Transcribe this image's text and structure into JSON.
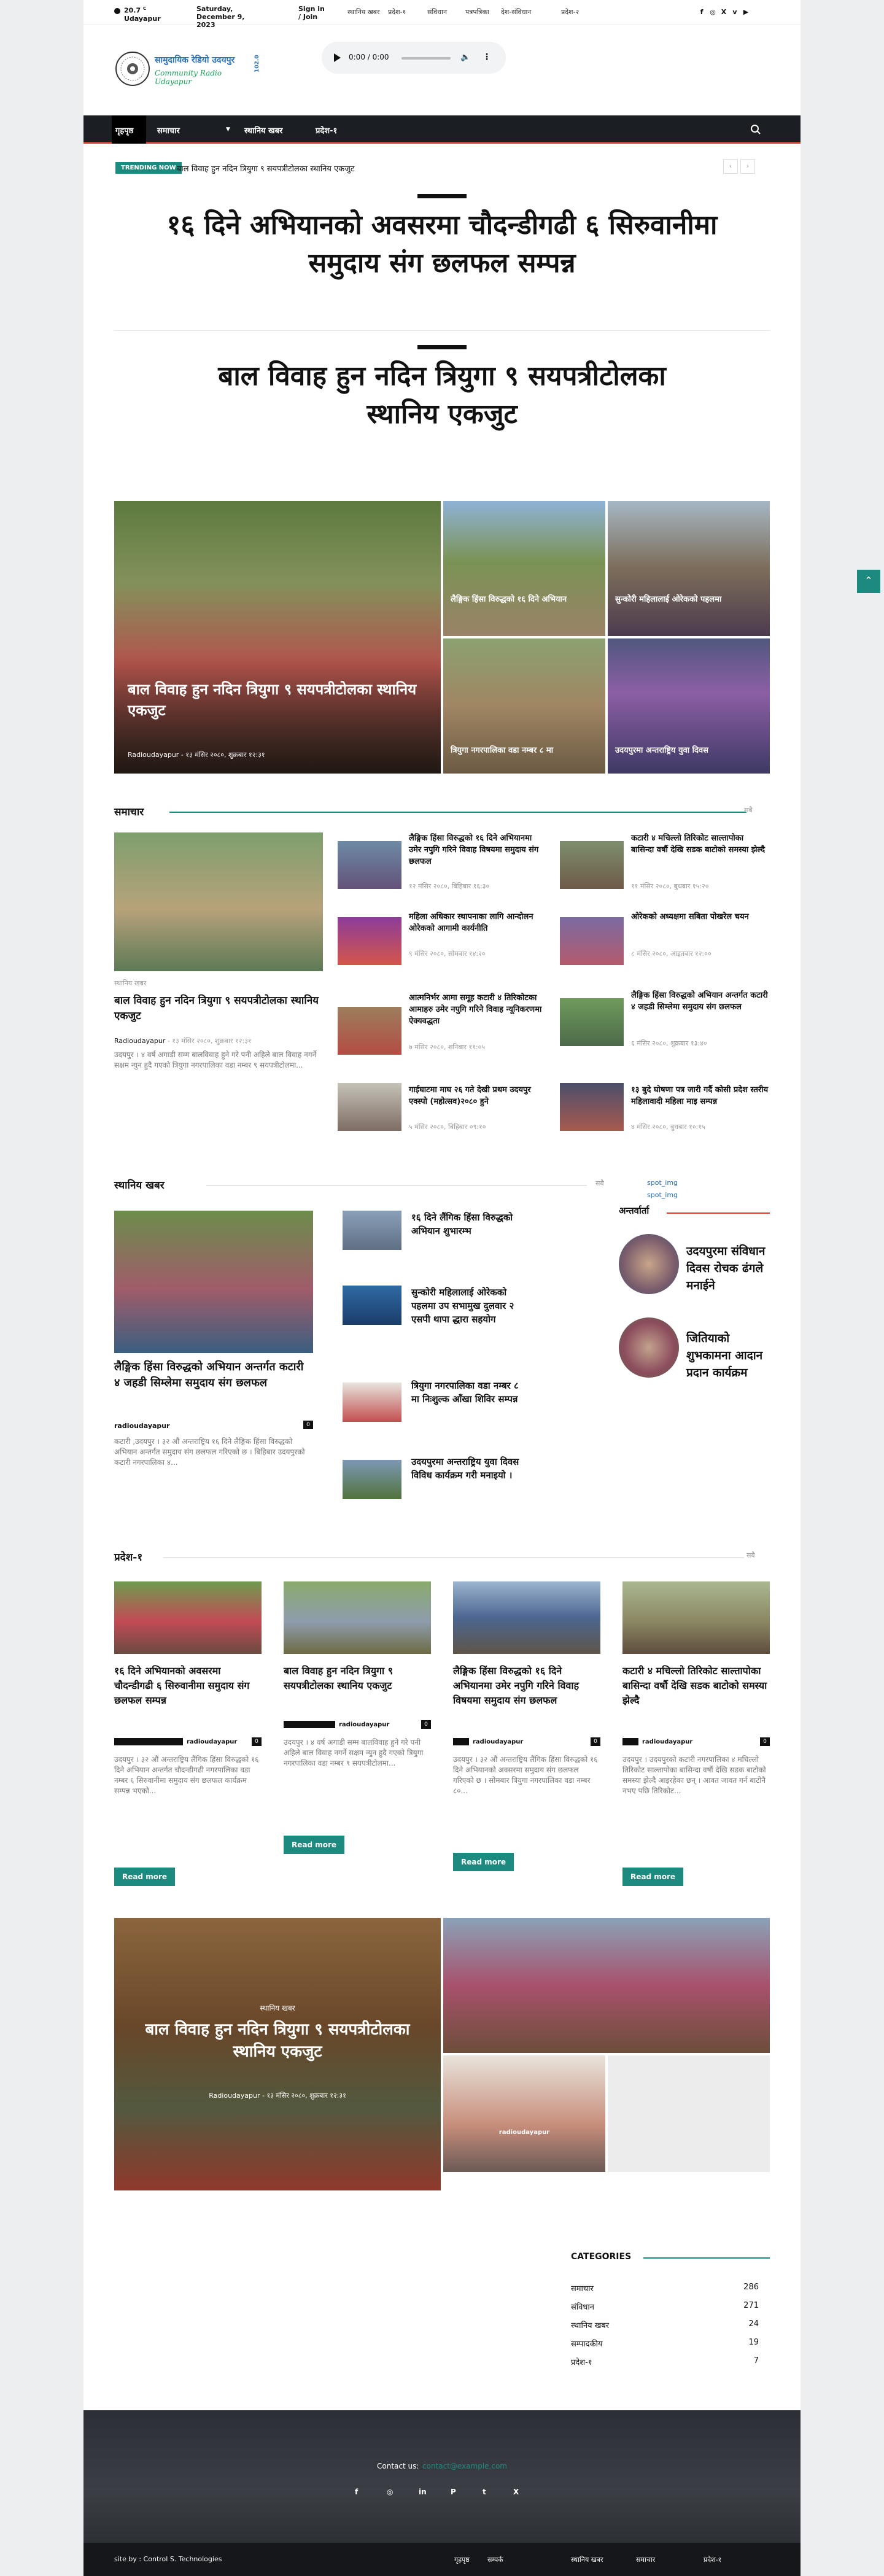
{
  "topbar": {
    "weather_temp": "20.7",
    "weather_unit": "C",
    "weather_city": "Udayapur",
    "date": "Saturday, December 9, 2023",
    "signin": "Sign in / Join",
    "links": [
      "स्थानिय खबर",
      "प्रदेश-१",
      "संविधान",
      "पत्रपत्रिका",
      "देश-संविधान",
      "प्रदेश-२"
    ]
  },
  "header": {
    "logo_title": "सामुदायिक रेडियो उदयपुर",
    "logo_sub": "Community Radio Udayapur",
    "logo_freq": "102.0",
    "player_time": "0:00 / 0:00"
  },
  "nav": {
    "items": [
      "गृहपृष्ठ",
      "समाचार",
      "स्थानिय खबर",
      "प्रदेश-१"
    ],
    "search_icon": "search-icon"
  },
  "trending": {
    "label": "TRENDING NOW",
    "text": "बाल विवाह हुन नदिन त्रियुगा ९ सयपत्रीटोलका स्थानिय एकजुट"
  },
  "hero1": "१६ दिने अभियानको अवसरमा चौदन्डीगढी ६ सिरुवानीमा समुदाय संग छलफल सम्पन्न",
  "hero2": "बाल विवाह हुन नदिन त्रियुगा ९ सयपत्रीटोलका स्थानिय एकजुट",
  "grid": {
    "main_title": "बाल विवाह हुन नदिन त्रियुगा ९ सयपत्रीटोलका स्थानिय एकजुट",
    "main_author": "Radioudayapur",
    "main_date": "१३ मंसिर २०८०, शुक्रबार १२:३१",
    "t2": "लैङ्गिक हिंसा विरुद्धको १६ दिने अभियान",
    "t3": "सुन्कोरी महिलालाई ओरेकको पहलमा",
    "t4": "त्रियुगा नगरपालिका वडा नम्बर ८ मा",
    "t5": "उदयपुरमा अन्तराष्ट्रिय युवा दिवस"
  },
  "samachar": {
    "heading": "समाचार",
    "all": "सबै",
    "main": {
      "cat": "स्थानिय खबर",
      "title": "बाल विवाह हुन नदिन त्रियुगा ९ सयपत्रीटोलका स्थानिय एकजुट",
      "author": "Radioudayapur",
      "date": "१३ मंसिर २०८०, शुक्रबार १२:३१",
      "excerpt": "उदयपुर । ४ वर्ष अगाडी सम्म बालविवाह हुने गरे पनी अहिले बाल विवाह नगर्ने सक्षम न्युन हुदै गएको त्रियुगा नगरपालिका वडा नम्बर ९ सयपत्रीटोलमा..."
    },
    "col2": [
      {
        "title": "लैङ्गिक हिंसा विरुद्धको १६ दिने अभियानमा उमेर नपुगि गरिने विवाह विषयमा समुदाय संग छलफल",
        "date": "१२ मंसिर २०८०, बिहिबार १६:३०"
      },
      {
        "title": "महिला अधिकार स्थापनाका लागि आन्दोलन ओरेकको आगामी कार्यनीति",
        "date": "९ मंसिर २०८०, सोमबार १४:२०"
      },
      {
        "title": "आत्मनिर्भर आमा समूह कटारी ४ तिरिकोटका आमाहरु उमेर नपुगि गरिने विवाह न्यूनिकरणमा ऐक्यवद्धता",
        "date": "७ मंसिर २०८०, शनिबार ११:०५"
      },
      {
        "title": "गाईघाटमा माघ २६ गते देखी प्रथम उदयपुर एक्स्पो (महोत्सव)२०८० हुने",
        "date": "५ मंसिर २०८०, बिहिबार ०९:१०"
      }
    ],
    "col3": [
      {
        "title": "कटारी ४ मचिल्लो तिरिकोट साल्तापोका बासिन्दा वर्षौ देखि सडक बाटोको समस्या झेल्दै",
        "date": "११ मंसिर २०८०, बुधबार १५:२०"
      },
      {
        "title": "ओरेकको अध्यक्षमा सबिता पोखरेल चयन",
        "date": "८ मंसिर २०८०, आइतबार १२:००"
      },
      {
        "title": "लैङ्गिक हिंसा विरुद्धको अभियान अन्तर्गत कटारी ४ जहडी सिम्लेमा समुदाय संग छलफल",
        "date": "६ मंसिर २०८०, शुक्रबार १३:४०"
      },
      {
        "title": "१३ बुदे घोषणा पत्र जारी गर्दै कोसी प्रदेश स्तरीय महिलावादी महिला माइ सम्पन्न",
        "date": "४ मंसिर २०८०, बुधबार १०:१५"
      }
    ]
  },
  "sthaniya": {
    "heading": "स्थानिय खबर",
    "all": "सबै",
    "main": {
      "title": "लैङ्गिक हिंसा विरुद्धको अभियान अन्तर्गत कटारी ४ जहडी सिम्लेमा समुदाय संग छलफल",
      "author": "radioudayapur",
      "count": "0",
      "excerpt": "कटारी ,उदयपुर । ३२ औं अन्तराष्ट्रिय १६ दिने लैङ्गिक हिंसा विरुद्धको अभियान अन्तर्गत समुदाय संग छलफल गरिएको छ । बिहिबार उदयपुरको कटारी नगरपालिका ४..."
    },
    "list": [
      "१६ दिने लैंगिक हिंसा विरुद्धको अभियान शुभारम्भ",
      "सुन्कोरी महिलालाई ओरेकको पहलमा उप सभामुख दुलवार २ एसपी थापा द्धारा सहयोग",
      "त्रियुगा नगरपालिका वडा नम्बर ८ मा निःशुल्क आँखा शिविर सम्पन्न",
      "उदयपुरमा अन्तराष्ट्रिय युवा दिवस विविध कार्यक्रम गरी मनाइयो ।"
    ]
  },
  "sidebar": {
    "ad_alt": "spot_img",
    "heading": "अन्तर्वार्ता",
    "items": [
      "उदयपुरमा संविधान दिवस रोचक ढंगले मनाईने",
      "जितियाको शुभकामना आदान प्रदान कार्यक्रम"
    ]
  },
  "pradesh": {
    "heading": "प्रदेश-१",
    "all": "सबै",
    "cards": [
      {
        "title": "१६ दिने अभियानको अवसरमा चौदन्डीगढी ६ सिरुवानीमा समुदाय संग छलफल सम्पन्न",
        "author": "radioudayapur",
        "count": "0",
        "excerpt": "उदयपुर । ३२ औं अन्तराष्ट्रिय लैंगिक हिंसा विरुद्धको १६ दिने अभियान अन्तर्गत चौदन्डीगढी नगरपालिका वडा नम्बर ६ सिरुवानीमा समुदाय संग छलफल कार्यक्रम सम्पन्न भएको..."
      },
      {
        "title": "बाल विवाह हुन नदिन त्रियुगा ९ सयपत्रीटोलका स्थानिय एकजुट",
        "author": "radioudayapur",
        "count": "0",
        "excerpt": "उदयपुर । ४ वर्ष अगाडी सम्म बालविवाह हुने गरे पनी अहिले बाल विवाह नगर्ने सक्षम न्युन हुदै गएको त्रियुगा नगरपालिका वडा नम्बर ९ सयपत्रीटोलमा..."
      },
      {
        "title": "लैङ्गिक हिंसा विरुद्धको १६ दिने अभियानमा उमेर नपुगि गरिने विवाह विषयमा समुदाय संग छलफल",
        "author": "radioudayapur",
        "count": "0",
        "excerpt": "उदयपुर । ३२ औं अन्तराष्ट्रिय लैंगिक हिंसा विरुद्धको १६ दिने अभियानको अवसरमा समुदाय संग छलफल गरिएको छ । सोमबार त्रियुगा नगरपालिका वडा नम्बर ८०..."
      },
      {
        "title": "कटारी ४ मचिल्लो तिरिकोट साल्तापोका बासिन्दा वर्षौ देखि सडक बाटोको समस्या झेल्दै",
        "author": "radioudayapur",
        "count": "0",
        "excerpt": "उदयपुर । उदयपुरको कटारी नगरपालिका ४ मचिल्लो तिरिकोट साल्तापोका बासिन्दा वर्षौ देखि सडक बाटोको समस्या झेल्दै आइरहेका छन् । आवत जावत गर्न बाटोनै नभए पछि तिरिकोट..."
      }
    ],
    "readmore": "Read more"
  },
  "mosaic": {
    "cat": "स्थानिय खबर",
    "title": "बाल विवाह हुन नदिन त्रियुगा ९ सयपत्रीटोलका स्थानिय एकजुट",
    "author": "Radioudayapur",
    "date": "१३ मंसिर २०८०, शुक्रबार १२:३१",
    "author2": "radioudayapur"
  },
  "categories": {
    "heading": "CATEGORIES",
    "rows": [
      {
        "name": "समाचार",
        "count": "286"
      },
      {
        "name": "संविधान",
        "count": "271"
      },
      {
        "name": "स्थानिय खबर",
        "count": "24"
      },
      {
        "name": "सम्पादकीय",
        "count": "19"
      },
      {
        "name": "प्रदेश-१",
        "count": "7"
      }
    ]
  },
  "footer": {
    "contact_label": "Contact us:",
    "contact_email": "contact@example.com",
    "credit": "site by : Control S. Technologies",
    "links": [
      "गृहपृष्ठ",
      "सम्पर्क",
      "स्थानिय खबर",
      "समाचार",
      "प्रदेश-१"
    ]
  },
  "colors": {
    "accent": "#1c8a7e",
    "nav_bg": "#1b1e22",
    "nav_border": "#e0372d",
    "footer_bg": "#30343a"
  }
}
